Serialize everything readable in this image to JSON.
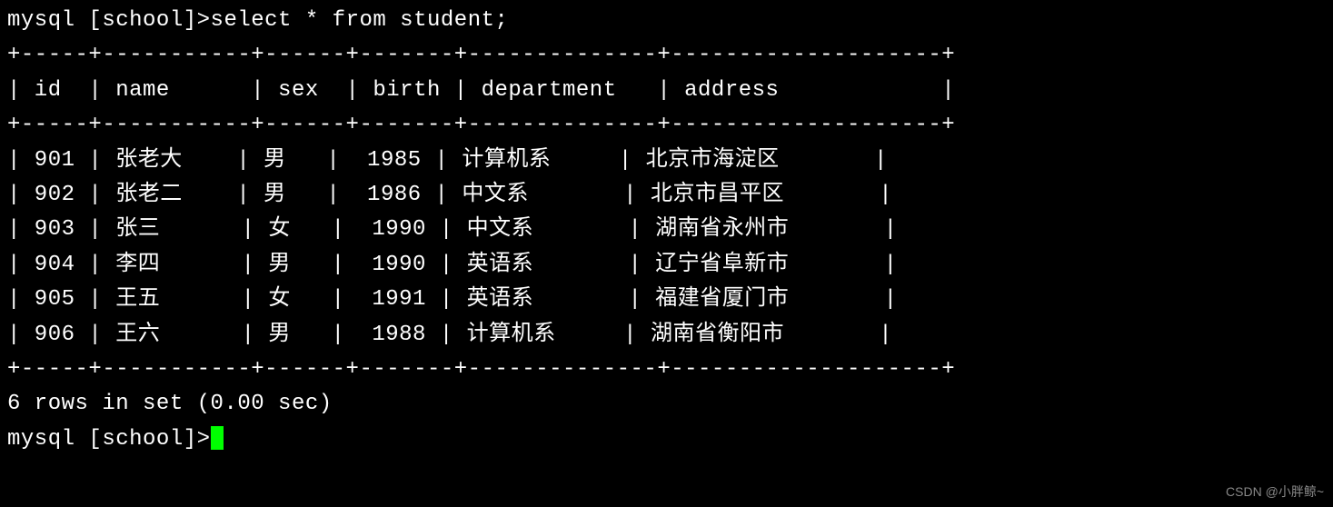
{
  "prompt1": "mysql [school]>",
  "command": "select * from student;",
  "border_top": "+-----+-----------+------+-------+--------------+--------------------+",
  "header_row": "| id  | name      | sex  | birth | department   | address            |",
  "border_mid": "+-----+-----------+------+-------+--------------+--------------------+",
  "rows": [
    "| 901 | 张老大    | 男   |  1985 | 计算机系     | 北京市海淀区       |",
    "| 902 | 张老二    | 男   |  1986 | 中文系       | 北京市昌平区       |",
    "| 903 | 张三      | 女   |  1990 | 中文系       | 湖南省永州市       |",
    "| 904 | 李四      | 男   |  1990 | 英语系       | 辽宁省阜新市       |",
    "| 905 | 王五      | 女   |  1991 | 英语系       | 福建省厦门市       |",
    "| 906 | 王六      | 男   |  1988 | 计算机系     | 湖南省衡阳市       |"
  ],
  "border_bot": "+-----+-----------+------+-------+--------------+--------------------+",
  "result_status": "6 rows in set (0.00 sec)",
  "blank": "",
  "prompt2": "mysql [school]>",
  "watermark": "CSDN @小胖鲸~",
  "chart_data": {
    "type": "table",
    "title": "student",
    "columns": [
      "id",
      "name",
      "sex",
      "birth",
      "department",
      "address"
    ],
    "data": [
      {
        "id": 901,
        "name": "张老大",
        "sex": "男",
        "birth": 1985,
        "department": "计算机系",
        "address": "北京市海淀区"
      },
      {
        "id": 902,
        "name": "张老二",
        "sex": "男",
        "birth": 1986,
        "department": "中文系",
        "address": "北京市昌平区"
      },
      {
        "id": 903,
        "name": "张三",
        "sex": "女",
        "birth": 1990,
        "department": "中文系",
        "address": "湖南省永州市"
      },
      {
        "id": 904,
        "name": "李四",
        "sex": "男",
        "birth": 1990,
        "department": "英语系",
        "address": "辽宁省阜新市"
      },
      {
        "id": 905,
        "name": "王五",
        "sex": "女",
        "birth": 1991,
        "department": "英语系",
        "address": "福建省厦门市"
      },
      {
        "id": 906,
        "name": "王六",
        "sex": "男",
        "birth": 1988,
        "department": "计算机系",
        "address": "湖南省衡阳市"
      }
    ]
  }
}
